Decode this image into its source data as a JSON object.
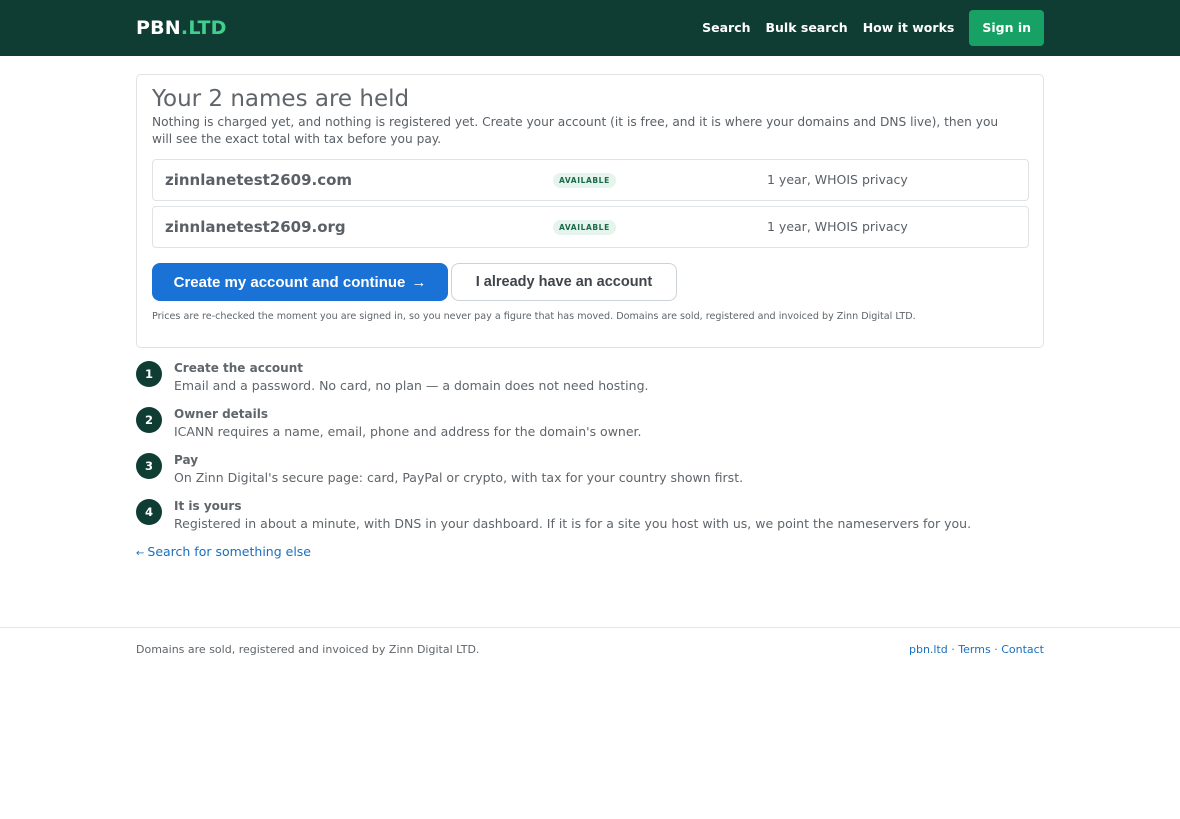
{
  "header": {
    "logo_main": "PBN",
    "logo_tld": ".LTD",
    "nav": [
      "Search",
      "Bulk search",
      "How it works"
    ],
    "signin": "Sign in"
  },
  "card": {
    "title": "Your 2 names are held",
    "intro": "Nothing is charged yet, and nothing is registered yet. Create your account (it is free, and it is where your domains and DNS live), then you will see the exact total with tax before you pay.",
    "domains": [
      {
        "name": "zinnlanetest2609.com",
        "status": "AVAILABLE",
        "term": "1 year, WHOIS privacy"
      },
      {
        "name": "zinnlanetest2609.org",
        "status": "AVAILABLE",
        "term": "1 year, WHOIS privacy"
      }
    ],
    "primary_button": "Create my account and continue",
    "primary_arrow": "→",
    "secondary_button": "I already have an account",
    "fine_print": "Prices are re-checked the moment you are signed in, so you never pay a figure that has moved. Domains are sold, registered and invoiced by Zinn Digital LTD."
  },
  "steps": [
    {
      "num": "1",
      "title": "Create the account",
      "desc": "Email and a password. No card, no plan — a domain does not need hosting."
    },
    {
      "num": "2",
      "title": "Owner details",
      "desc": "ICANN requires a name, email, phone and address for the domain's owner."
    },
    {
      "num": "3",
      "title": "Pay",
      "desc": "On Zinn Digital's secure page: card, PayPal or crypto, with tax for your country shown first."
    },
    {
      "num": "4",
      "title": "It is yours",
      "desc": "Registered in about a minute, with DNS in your dashboard. If it is for a site you host with us, we point the nameservers for you."
    }
  ],
  "back_link": {
    "arrow": "←",
    "label": "Search for something else"
  },
  "footer": {
    "left": "Domains are sold, registered and invoiced by Zinn Digital LTD.",
    "links": [
      "pbn.ltd",
      "Terms",
      "Contact"
    ],
    "sep": "·"
  },
  "colors": {
    "header_bg": "#0f3d33",
    "accent_green": "#17a165",
    "primary_blue": "#1a72d6",
    "link_blue": "#1a6fc0"
  }
}
